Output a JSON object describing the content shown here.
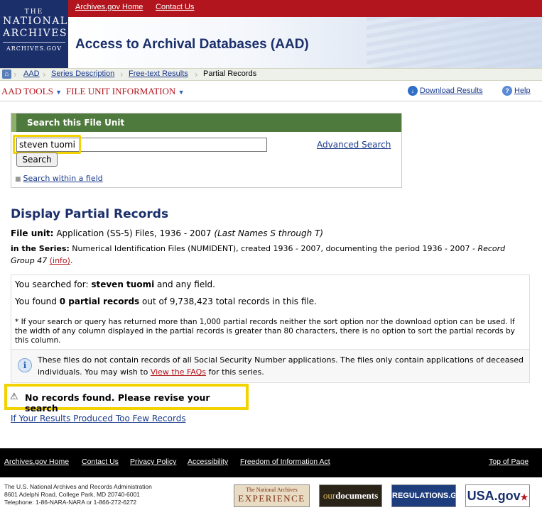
{
  "header": {
    "logo_line1": "THE",
    "logo_line2": "NATIONAL ARCHIVES",
    "logo_line3": "ARCHIVES.GOV",
    "top_links": [
      "Archives.gov Home",
      "Contact Us"
    ],
    "site_title": "Access to Archival Databases (AAD)"
  },
  "breadcrumb": [
    "AAD",
    "Series Description",
    "Free-text Results",
    "Partial Records"
  ],
  "toolbar": {
    "aad_tools": "AAD TOOLS",
    "file_unit_info": "FILE UNIT INFORMATION",
    "download": "Download Results",
    "help": "Help"
  },
  "search": {
    "heading": "Search this File Unit",
    "input_value": "steven tuomi",
    "button": "Search",
    "advanced": "Advanced Search",
    "within_field": "Search within a field"
  },
  "display": {
    "title": "Display Partial Records",
    "file_unit_label": "File unit:",
    "file_unit_value": "Application (SS-5) Files, 1936 - 2007",
    "file_unit_note": "(Last Names S through T)",
    "series_label": "in the Series:",
    "series_value": "Numerical Identification Files (NUMIDENT), created 1936 - 2007, documenting the period 1936 - 2007 -",
    "series_record_group": "Record Group 47",
    "info_link": "(info)",
    "period": "."
  },
  "results": {
    "searched_for_prefix": "You searched for:",
    "searched_term": "steven tuomi",
    "searched_for_suffix": "and any field.",
    "found_prefix": "You found",
    "found_count": "0 partial records",
    "found_suffix": "out of 9,738,423 total records in this file.",
    "footnote": "* If your search or query has returned more than 1,000 partial records neither the sort option nor the download option can be used. If the width of any column displayed in the partial records is greater than 80 characters, there is no option to sort the partial records by this column.",
    "info_text_1": "These files do not contain records of all Social Security Number applications. The files only contain applications of deceased individuals. You may wish to",
    "info_link": "View the FAQs",
    "info_text_2": "for this series."
  },
  "no_records": "No records found. Please revise your search",
  "too_few_link": "If Your Results Produced Too Few Records",
  "footer": {
    "links": [
      "Archives.gov Home",
      "Contact Us",
      "Privacy Policy",
      "Accessibility",
      "Freedom of Information Act"
    ],
    "top_of_page": "Top of Page",
    "address_1": "The U.S. National Archives and Records Administration",
    "address_2": "8601 Adelphi Road, College Park, MD 20740-6001",
    "address_3": "Telephone: 1-86-NARA-NARA or 1-866-272-6272",
    "logo_exp_1": "The National Archives",
    "logo_exp_2": "EXPERIENCE",
    "logo_ours_a": "our",
    "logo_ours_b": "documents",
    "logo_regs": "REGULATIONS.GOV",
    "logo_usa": "USA.gov"
  },
  "colors": {
    "brand_red": "#b2151d",
    "brand_navy": "#1b2f6b",
    "search_header_green": "#4f7a3e",
    "highlight_yellow": "#f2d200"
  }
}
